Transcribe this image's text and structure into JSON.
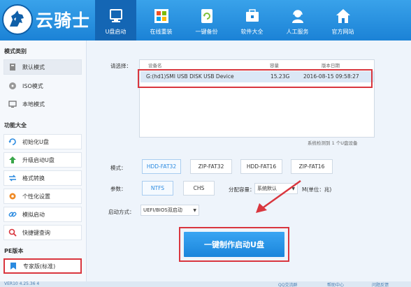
{
  "app": {
    "logo_text": "云骑士"
  },
  "nav": [
    {
      "label": "U盘启动",
      "icon": "usb-drive-icon",
      "active": true
    },
    {
      "label": "在线重装",
      "icon": "windows-icon",
      "active": false
    },
    {
      "label": "一键备份",
      "icon": "backup-icon",
      "active": false
    },
    {
      "label": "软件大全",
      "icon": "software-icon",
      "active": false
    },
    {
      "label": "人工服务",
      "icon": "support-agent-icon",
      "active": false
    },
    {
      "label": "官方网站",
      "icon": "home-icon",
      "active": false
    }
  ],
  "sidebar": {
    "mode_title": "模式类别",
    "modes": [
      {
        "label": "默认模式",
        "icon": "default-mode-icon"
      },
      {
        "label": "ISO模式",
        "icon": "iso-disc-icon"
      },
      {
        "label": "本地模式",
        "icon": "monitor-icon"
      }
    ],
    "func_title": "功能大全",
    "functions": [
      {
        "label": "初始化U盘",
        "icon": "refresh-icon"
      },
      {
        "label": "升级启动U盘",
        "icon": "upgrade-arrow-icon"
      },
      {
        "label": "格式转换",
        "icon": "convert-icon"
      },
      {
        "label": "个性化设置",
        "icon": "gear-icon"
      },
      {
        "label": "模拟启动",
        "icon": "link-icon"
      },
      {
        "label": "快捷键查询",
        "icon": "search-icon"
      }
    ],
    "pe_title": "PE版本",
    "pe_item": {
      "label": "专家版(标准)",
      "icon": "bookmark-icon"
    }
  },
  "main": {
    "select_label": "请选择：",
    "columns": {
      "device": "设备名",
      "capacity": "容量",
      "date": "版本日期"
    },
    "device": {
      "name": "G:(hd1)SMI USB DISK USB Device",
      "capacity": "15.23G",
      "date": "2016-08-15 09:58:27"
    },
    "status": "系统检测到 1 个U盘设备",
    "mode_label": "模式：",
    "modes": [
      "HDD-FAT32",
      "ZIP-FAT32",
      "HDD-FAT16",
      "ZIP-FAT16"
    ],
    "param_label": "参数：",
    "params": [
      "NTFS",
      "CHS"
    ],
    "alloc_label": "分配容量：",
    "alloc_value": "系统默认",
    "unit_label": "M(单位：兆)",
    "boot_label": "启动方式：",
    "boot_value": "UEFI/BIOS双启动",
    "make_button": "一键制作启动U盘"
  },
  "footer": {
    "version": "VER10 4.25.36 4",
    "qq": "QQ交流群",
    "help": "帮助中心",
    "feedback": "问题反馈"
  },
  "colors": {
    "header": "#2a92e2",
    "active_nav": "#1466b4",
    "highlight": "#d9363e",
    "button": "#2a95ea"
  }
}
